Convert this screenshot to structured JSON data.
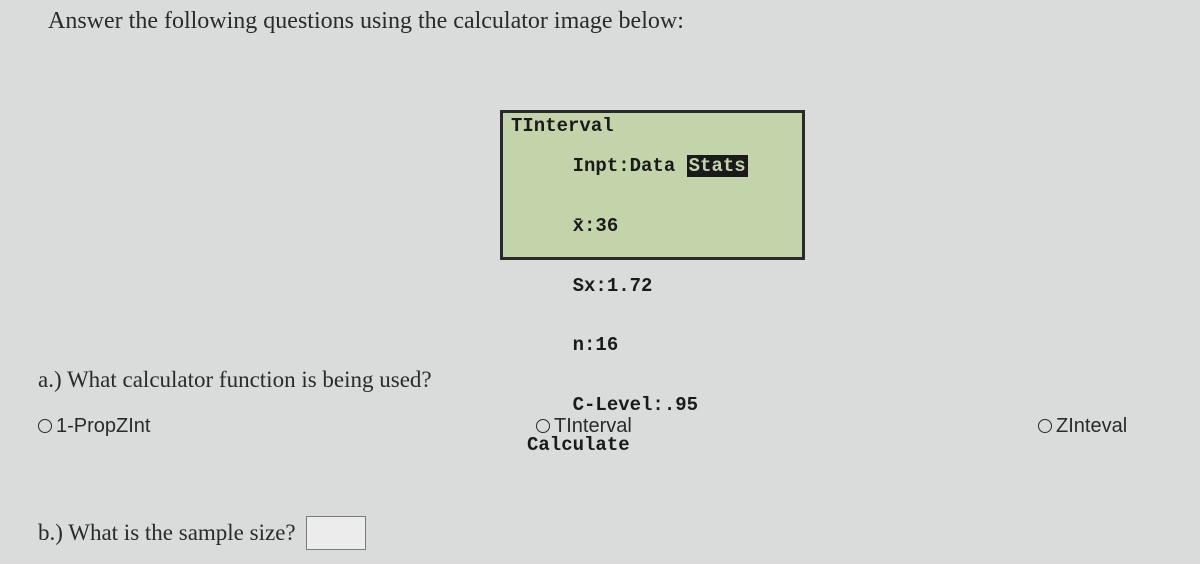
{
  "instruction": "Answer the following questions using the calculator image below:",
  "calculator": {
    "title": "TInterval",
    "inpt_label": "Inpt:",
    "inpt_data": "Data",
    "inpt_stats": "Stats",
    "xbar_label": "x̄:",
    "xbar_value": "36",
    "sx_label": "Sx:",
    "sx_value": "1.72",
    "n_label": "n:",
    "n_value": "16",
    "clevel_label": "C-Level:",
    "clevel_value": ".95",
    "calculate": "Calculate"
  },
  "question_a": {
    "prompt": "a.) What calculator function is being used?",
    "options": {
      "opt1": "1-PropZInt",
      "opt2": "TInterval",
      "opt3": "ZInteval"
    }
  },
  "question_b": {
    "prompt": "b.) What is the sample size?",
    "value": ""
  }
}
